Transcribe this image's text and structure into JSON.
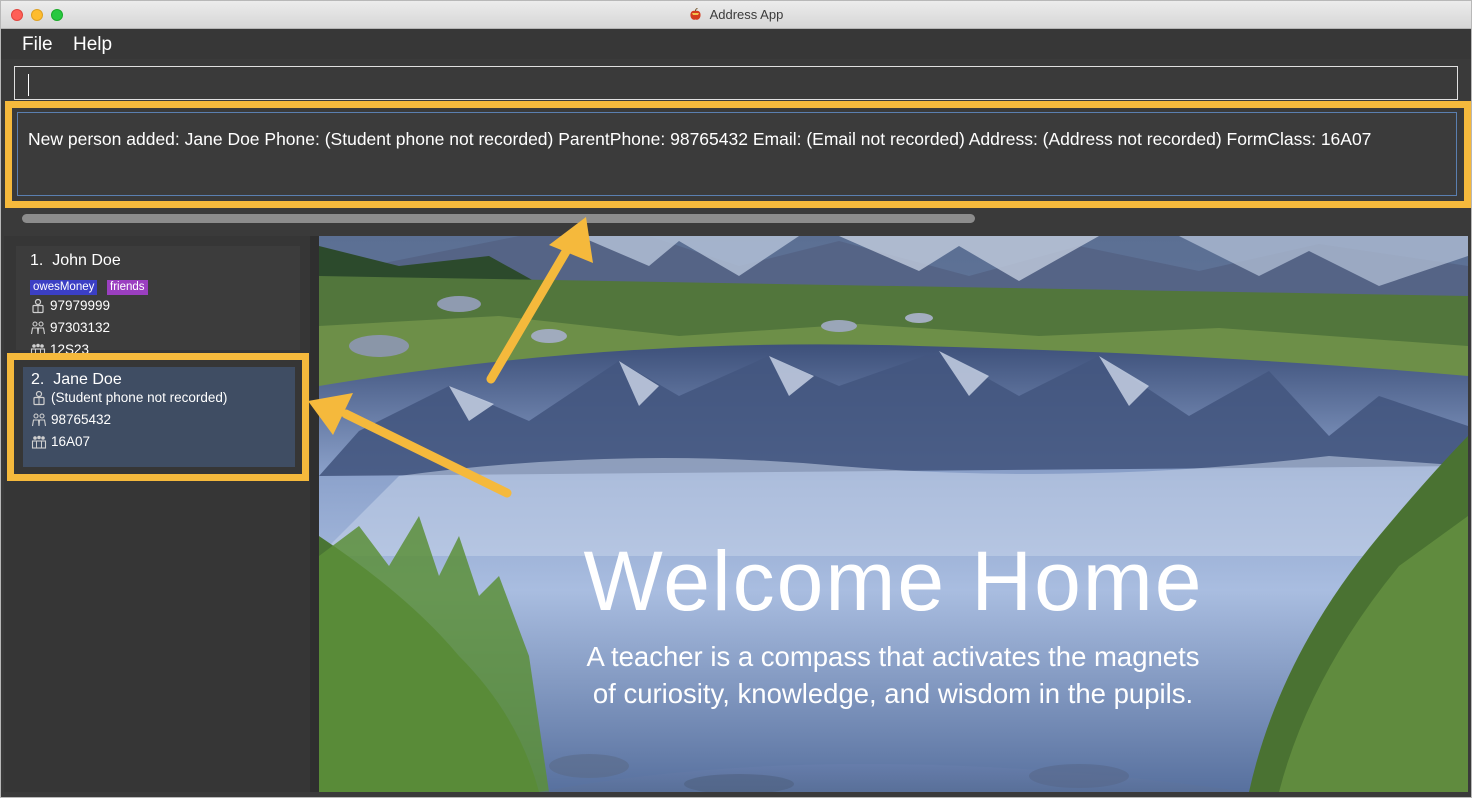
{
  "window": {
    "title": "Address App"
  },
  "menu": {
    "items": [
      "File",
      "Help"
    ]
  },
  "command_box": {
    "value": ""
  },
  "result_display": {
    "text": "New person added: Jane Doe Phone: (Student phone not recorded) ParentPhone: 98765432 Email: (Email not recorded) Address: (Address not recorded) FormClass: 16A07"
  },
  "person_list": [
    {
      "index": "1.",
      "name": "John Doe",
      "tags": [
        "owesMoney",
        "friends"
      ],
      "student_phone": "97979999",
      "parent_phone": "97303132",
      "form_class": "12S23"
    },
    {
      "index": "2.",
      "name": "Jane Doe",
      "tags": [],
      "student_phone": "(Student phone not recorded)",
      "parent_phone": "98765432",
      "form_class": "16A07"
    }
  ],
  "welcome": {
    "title": "Welcome Home",
    "quote": "A teacher is a compass that activates the magnets of curiosity, knowledge, and wisdom in the pupils."
  },
  "icons": {
    "app": "address-app-icon",
    "student_phone": "student-phone-icon",
    "parent_phone": "parent-phone-icon",
    "form_class": "form-class-icon"
  },
  "colors": {
    "annotation": "#f5b93c",
    "tag_owesMoney": "#3b3fc4",
    "tag_friends": "#9b3fc0",
    "selected_card": "#3f4d63"
  }
}
